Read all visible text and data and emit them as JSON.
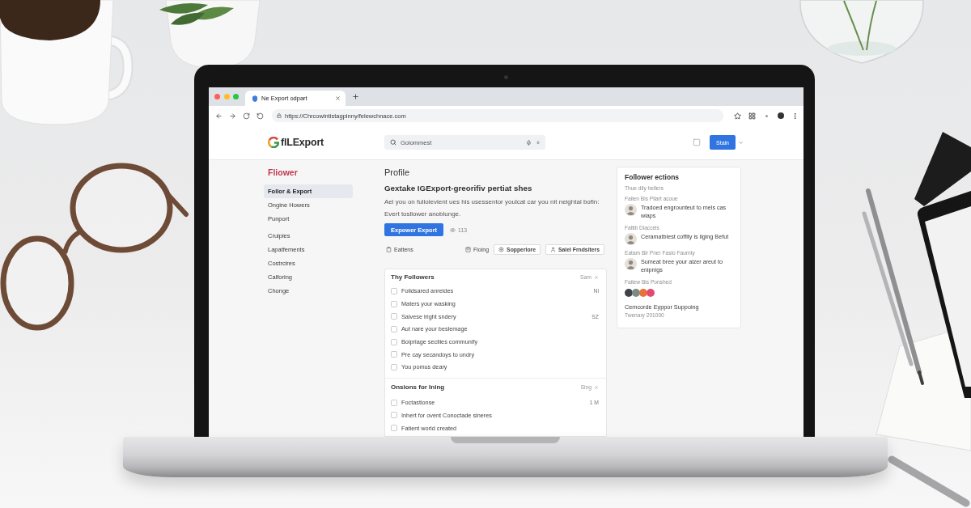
{
  "browser": {
    "tab_title": "Ne Export odpart",
    "url": "https://Chrcowintistagpinny/felewchnace.com"
  },
  "header": {
    "logo": "flLExport",
    "search": {
      "placeholder": "Golommest"
    },
    "button": "Stain"
  },
  "sidebar": {
    "title": "Fliower",
    "sections": [
      {
        "items": [
          {
            "label": "Follor & Export",
            "selected": true
          },
          {
            "label": "Ongine Howers",
            "selected": false
          },
          {
            "label": "Punport",
            "selected": false
          }
        ]
      },
      {
        "items": [
          {
            "label": "Cruipies",
            "selected": false
          },
          {
            "label": "Lapatfements",
            "selected": false
          },
          {
            "label": "Costrcires",
            "selected": false
          },
          {
            "label": "Calforing",
            "selected": false
          },
          {
            "label": "Chonge",
            "selected": false
          }
        ]
      }
    ]
  },
  "profile": {
    "title": "Profile",
    "heading": "Gextake IGExport-greorifiv pertiat shes",
    "description": "Ael you on fullolevient ues his usessentor youlcat car you nit neightal bofin: Evert tosllower anoblunge.",
    "primary_button": "Expower Export",
    "views": "113",
    "toolbar": {
      "start": [
        {
          "kind": "link",
          "label": "Eattens"
        }
      ],
      "end": [
        {
          "kind": "link",
          "label": "Fioing"
        },
        {
          "kind": "button",
          "label": "Sopperlore"
        },
        {
          "kind": "button",
          "label": "Salel Frndsiters"
        }
      ]
    }
  },
  "lists": [
    {
      "title": "Thy Followers",
      "action": "Sam",
      "items": [
        {
          "label": "Folidsared anreides",
          "count": "Nl",
          "checked": false
        },
        {
          "label": "Maters your wasking",
          "checked": false
        },
        {
          "label": "Saivese lright sndery",
          "count": "SZ",
          "checked": false
        },
        {
          "label": "Aut nare your beslemage",
          "checked": false
        },
        {
          "label": "Boipriage secilies communify",
          "checked": false
        },
        {
          "label": "Pre cay secandoys to undry",
          "checked": false
        },
        {
          "label": "You pomus deary",
          "checked": false
        }
      ]
    },
    {
      "title": "Onsions for Ining",
      "action": "Sing",
      "items": [
        {
          "label": "Foctastionse",
          "count": "1 M",
          "checked": false
        },
        {
          "label": "Inhert for ovent Conoctade sineres",
          "checked": false
        },
        {
          "label": "Fatient world created",
          "checked": false
        }
      ]
    }
  ],
  "activity": {
    "title": "Follower ections",
    "subtitle": "Thue dily hellers",
    "entries": [
      {
        "label": "Fallen Bis Pliart acoue",
        "text": "Tradoed engrounteut to mels cas wiaps"
      },
      {
        "label": "Faltib Diaccels",
        "text": "Ceramatblest coffity is ilging Befut"
      },
      {
        "label": "Eatam Bir Pner Faslo Faurnty",
        "text": "Sumeat bree your alzer areut to enipnigs"
      }
    ],
    "apps_label": "Failew Bis Ponshed",
    "apps": [
      {
        "color": "#3f4448"
      },
      {
        "color": "#7d8a86"
      },
      {
        "color": "#e8733a"
      },
      {
        "color": "#e24b6d"
      }
    ],
    "footer_title": "Cemcorde Eyppor Suppoing",
    "footer_date": "Twenary 201000"
  }
}
